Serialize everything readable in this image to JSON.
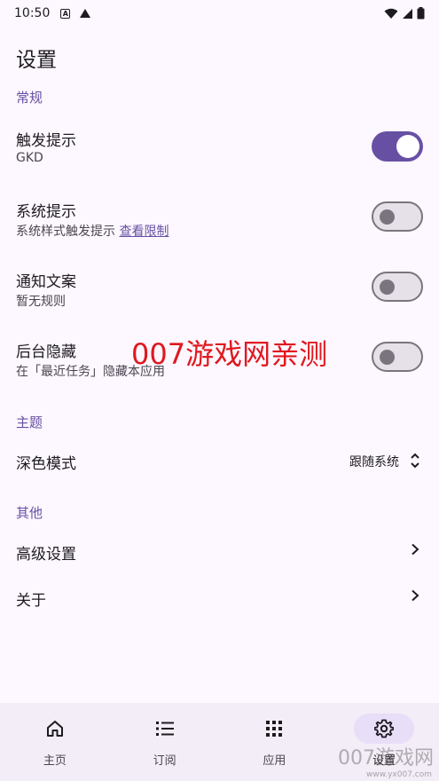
{
  "status": {
    "time": "10:50"
  },
  "page": {
    "title": "设置"
  },
  "sections": {
    "general": "常规",
    "theme": "主题",
    "other": "其他"
  },
  "rows": {
    "trigger": {
      "title": "触发提示",
      "subtitle": "GKD",
      "enabled": true
    },
    "system": {
      "title": "系统提示",
      "subtitle": "系统样式触发提示",
      "link": "查看限制",
      "enabled": false
    },
    "notify": {
      "title": "通知文案",
      "subtitle": "暂无规则",
      "enabled": false
    },
    "background": {
      "title": "后台隐藏",
      "subtitle": "在「最近任务」隐藏本应用",
      "enabled": false
    },
    "dark_mode": {
      "title": "深色模式",
      "value": "跟随系统"
    },
    "advanced": {
      "title": "高级设置"
    },
    "about": {
      "title": "关于"
    }
  },
  "watermark": {
    "text": "007游戏网亲测",
    "corner": "007游戏网",
    "corner_sub": "www.yx007.com"
  },
  "nav": {
    "items": [
      {
        "label": "主页",
        "icon": "home-icon"
      },
      {
        "label": "订阅",
        "icon": "list-icon"
      },
      {
        "label": "应用",
        "icon": "apps-grid-icon"
      },
      {
        "label": "设置",
        "icon": "gear-icon",
        "active": true
      }
    ]
  },
  "colors": {
    "accent": "#6750A4",
    "background": "#FDF7FF",
    "nav_bg": "#F3EDF7",
    "watermark": "#E0181F"
  }
}
